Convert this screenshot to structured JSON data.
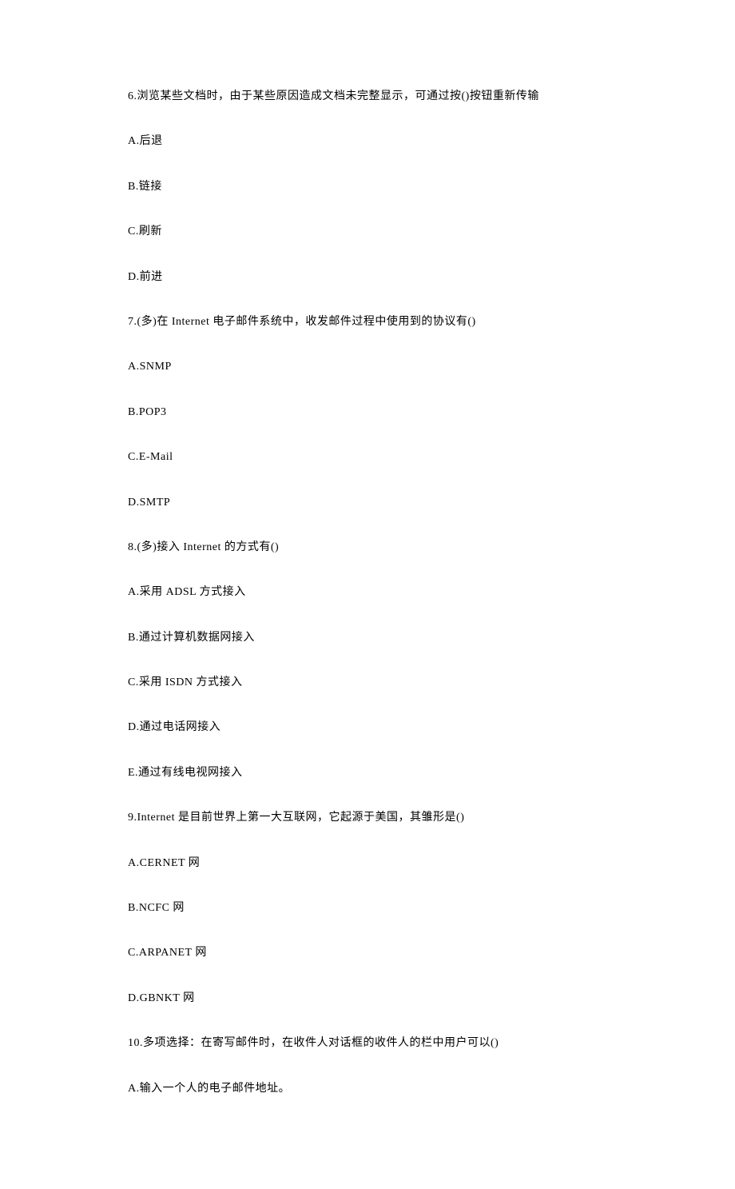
{
  "lines": [
    "6.浏览某些文档时，由于某些原因造成文档未完整显示，可通过按()按钮重新传输",
    "A.后退",
    "B.链接",
    "C.刷新",
    "D.前进",
    "7.(多)在 Internet 电子邮件系统中，收发邮件过程中使用到的协议有()",
    "A.SNMP",
    "B.POP3",
    "C.E-Mail",
    "D.SMTP",
    "8.(多)接入 Internet 的方式有()",
    "A.采用 ADSL 方式接入",
    "B.通过计算机数据网接入",
    "C.采用 ISDN 方式接入",
    "D.通过电话网接入",
    "E.通过有线电视网接入",
    "9.Internet 是目前世界上第一大互联网，它起源于美国，其雏形是()",
    "A.CERNET 网",
    "B.NCFC 网",
    "C.ARPANET 网",
    "D.GBNKT 网",
    "10.多项选择：在寄写邮件时，在收件人对话框的收件人的栏中用户可以()",
    "A.输入一个人的电子邮件地址。"
  ]
}
